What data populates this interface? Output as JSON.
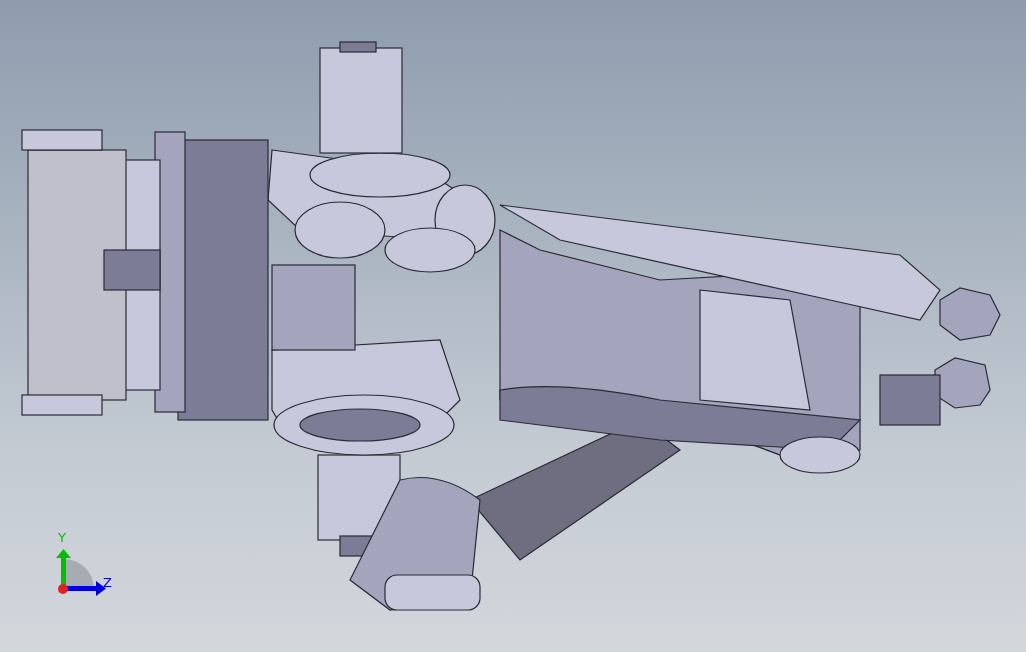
{
  "viewport": {
    "triad": {
      "axes": [
        {
          "kind": "vertical",
          "label": "Y",
          "color": "#00c000"
        },
        {
          "kind": "horizontal",
          "label": "Z",
          "color": "#0000e0"
        }
      ]
    }
  }
}
